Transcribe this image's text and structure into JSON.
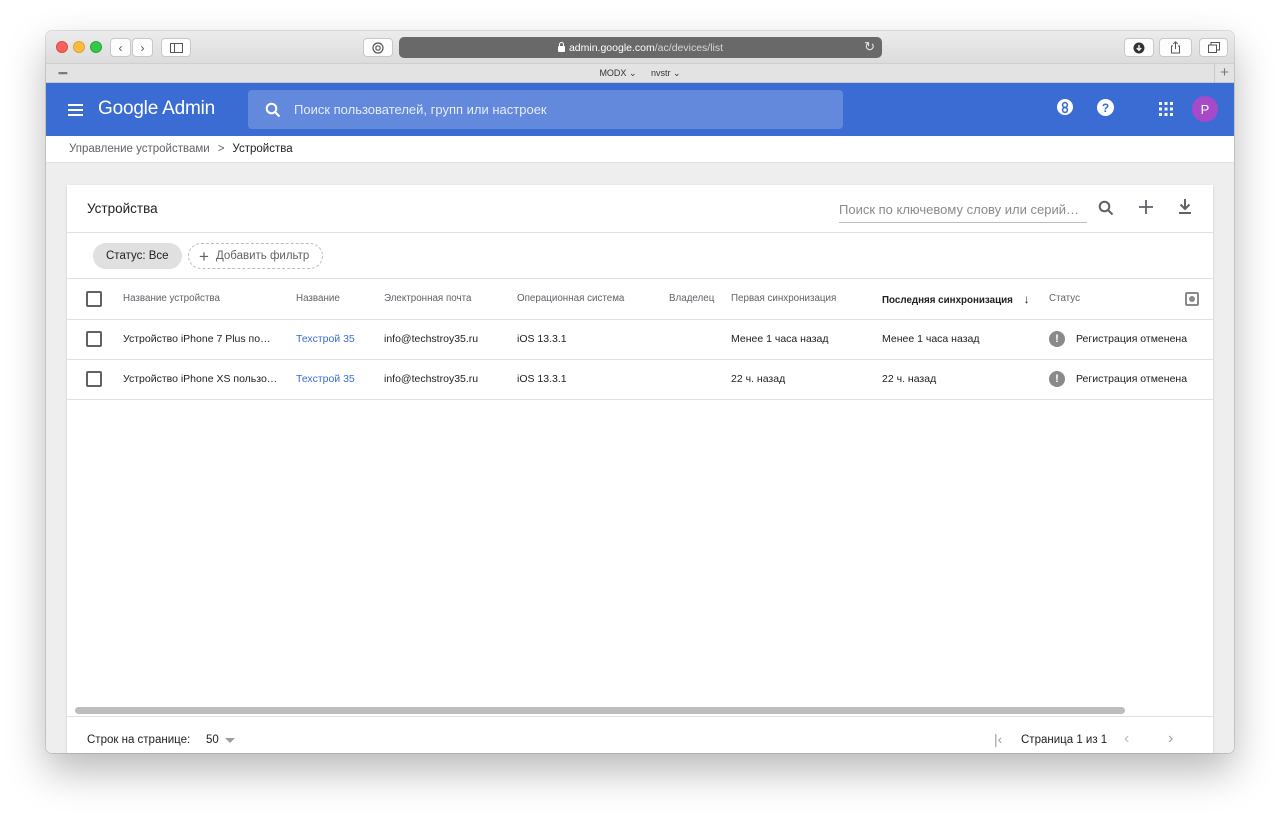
{
  "browser": {
    "address_host": "admin.google.com",
    "address_path": "/ac/devices/list",
    "favorites": [
      "MODX ⌄",
      "nvstr ⌄"
    ]
  },
  "header": {
    "brand": "Google Admin",
    "search_placeholder": "Поиск пользователей, групп или настроек",
    "avatar_letter": "P",
    "accent_color": "#3b6cd3"
  },
  "breadcrumb": {
    "parent": "Управление устройствами",
    "separator": ">",
    "current": "Устройства"
  },
  "card": {
    "title": "Устройства",
    "keyword_placeholder": "Поиск по ключевому слову или серий…"
  },
  "filters": {
    "status_chip": "Статус: Все",
    "add_filter": "Добавить фильтр"
  },
  "table": {
    "columns": [
      "Название устройства",
      "Название",
      "Электронная почта",
      "Операционная система",
      "Владелец",
      "Первая синхронизация",
      "Последняя синхронизация",
      "Статус"
    ],
    "sort_indicator": "↓",
    "rows": [
      {
        "device": "Устройство iPhone 7 Plus по…",
        "name": "Техстрой 35",
        "email": "info@techstroy35.ru",
        "os": "iOS 13.3.1",
        "owner": "",
        "first_sync": "Менее 1 часа назад",
        "last_sync": "Менее 1 часа назад",
        "status": "Регистрация отменена"
      },
      {
        "device": "Устройство iPhone XS пользо…",
        "name": "Техстрой 35",
        "email": "info@techstroy35.ru",
        "os": "iOS 13.3.1",
        "owner": "",
        "first_sync": "22 ч. назад",
        "last_sync": "22 ч. назад",
        "status": "Регистрация отменена"
      }
    ]
  },
  "footer": {
    "rows_per_page_label": "Строк на странице:",
    "rows_per_page_value": "50",
    "page_label": "Страница 1 из 1"
  }
}
